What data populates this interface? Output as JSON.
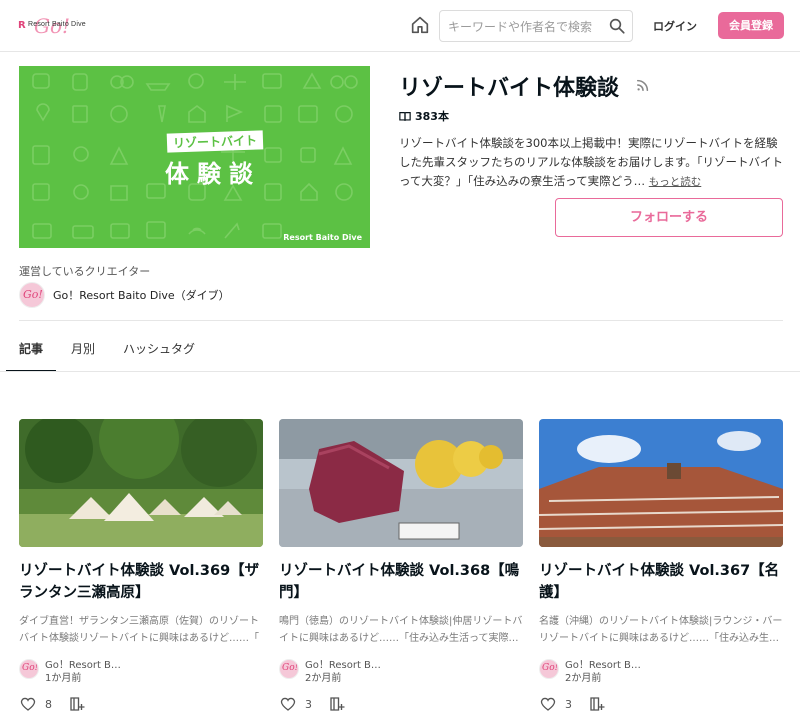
{
  "header": {
    "logo_text": "Resort Baito Dive",
    "search_placeholder": "キーワードや作者名で検索",
    "login_label": "ログイン",
    "signup_label": "会員登録"
  },
  "magazine": {
    "title": "リゾートバイト体験談",
    "count": "383本",
    "description": "リゾートバイト体験談を300本以上掲載中！実際にリゾートバイトを経験した先輩スタッフたちのリアルな体験談をお届けします。「リゾートバイトって大変？」「住み込みの寮生活って実際どう…",
    "more_label": "もっと読む",
    "follow_label": "フォローする",
    "image_badge_top": "リゾートバイト",
    "image_badge_main": "体験談",
    "image_brand": "Resort Baito Dive"
  },
  "creator": {
    "label": "運営しているクリエイター",
    "name": "Go！Resort Baito Dive（ダイブ）",
    "avatar_text": "Go!"
  },
  "tabs": [
    {
      "label": "記事"
    },
    {
      "label": "月別"
    },
    {
      "label": "ハッシュタグ"
    }
  ],
  "articles": [
    {
      "title": "リゾートバイト体験談 Vol.369【ザランタン三瀬高原】",
      "desc": "ダイブ直営！ザランタン三瀬高原（佐賀）のリゾートバイト体験談リゾートバイトに興味はあるけど……「",
      "author": "Go！Resort B…",
      "time": "1か月前",
      "likes": "8"
    },
    {
      "title": "リゾートバイト体験談 Vol.368【鳴門】",
      "desc": "鳴門（徳島）のリゾートバイト体験談|仲居リゾートバイトに興味はあるけど……「住み込み生活って実際…",
      "author": "Go！Resort B…",
      "time": "2か月前",
      "likes": "3"
    },
    {
      "title": "リゾートバイト体験談 Vol.367【名護】",
      "desc": "名護（沖縄）のリゾートバイト体験談|ラウンジ・バーリゾートバイトに興味はあるけど……「住み込み生…",
      "author": "Go！Resort B…",
      "time": "2か月前",
      "likes": "3"
    }
  ],
  "colors": {
    "accent": "#e96a9a",
    "hero_green": "#5cc144"
  }
}
